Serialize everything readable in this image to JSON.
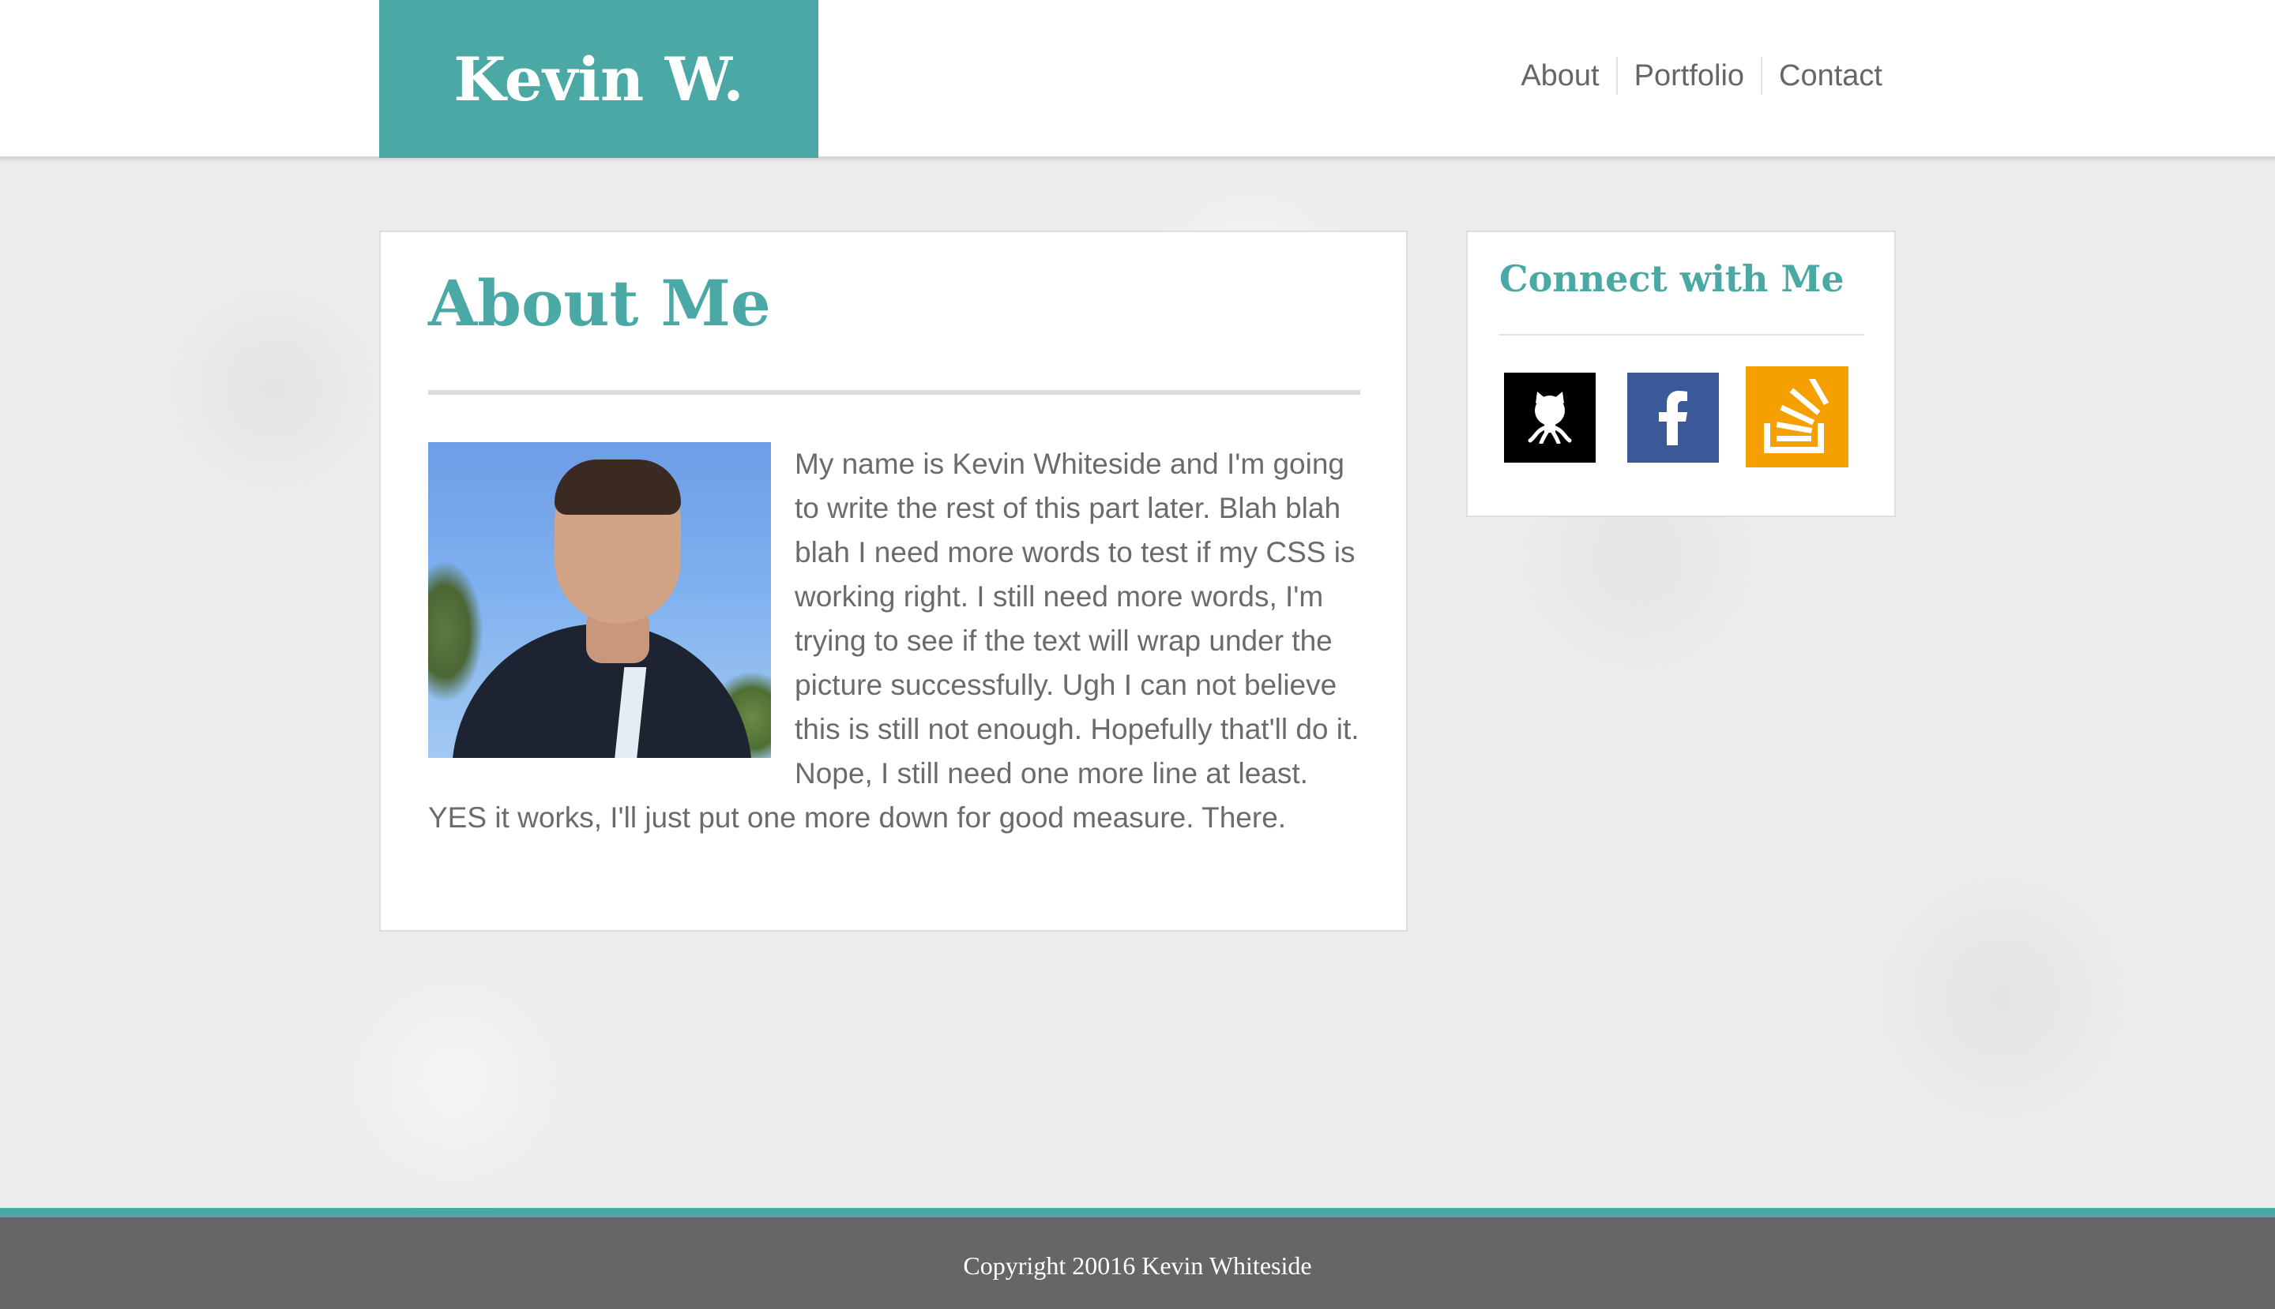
{
  "header": {
    "brand": "Kevin W.",
    "nav": [
      {
        "label": "About"
      },
      {
        "label": "Portfolio"
      },
      {
        "label": "Contact"
      }
    ]
  },
  "about": {
    "title": "About Me",
    "photo_alt": "Photo of Kevin Whiteside",
    "body": "My name is Kevin Whiteside and I'm going to write the rest of this part later. Blah blah blah I need more words to test if my CSS is working right. I still need more words, I'm trying to see if the text will wrap under the picture successfully. Ugh I can not believe this is still not enough. Hopefully that'll do it. Nope, I still need one more line at least. YES it works, I'll just put one more down for good measure. There."
  },
  "sidebar": {
    "title": "Connect with Me",
    "social": [
      {
        "name": "github",
        "icon": "github-octocat-icon",
        "color": "#000000"
      },
      {
        "name": "facebook",
        "icon": "facebook-f-icon",
        "color": "#3b5998"
      },
      {
        "name": "stackoverflow",
        "icon": "stackoverflow-icon",
        "color": "#f5a000"
      }
    ]
  },
  "footer": {
    "copyright": "Copyright 20016 Kevin Whiteside"
  },
  "colors": {
    "accent": "#4aa9a4",
    "footer_bg": "#666666",
    "text": "#6b6b6b"
  }
}
